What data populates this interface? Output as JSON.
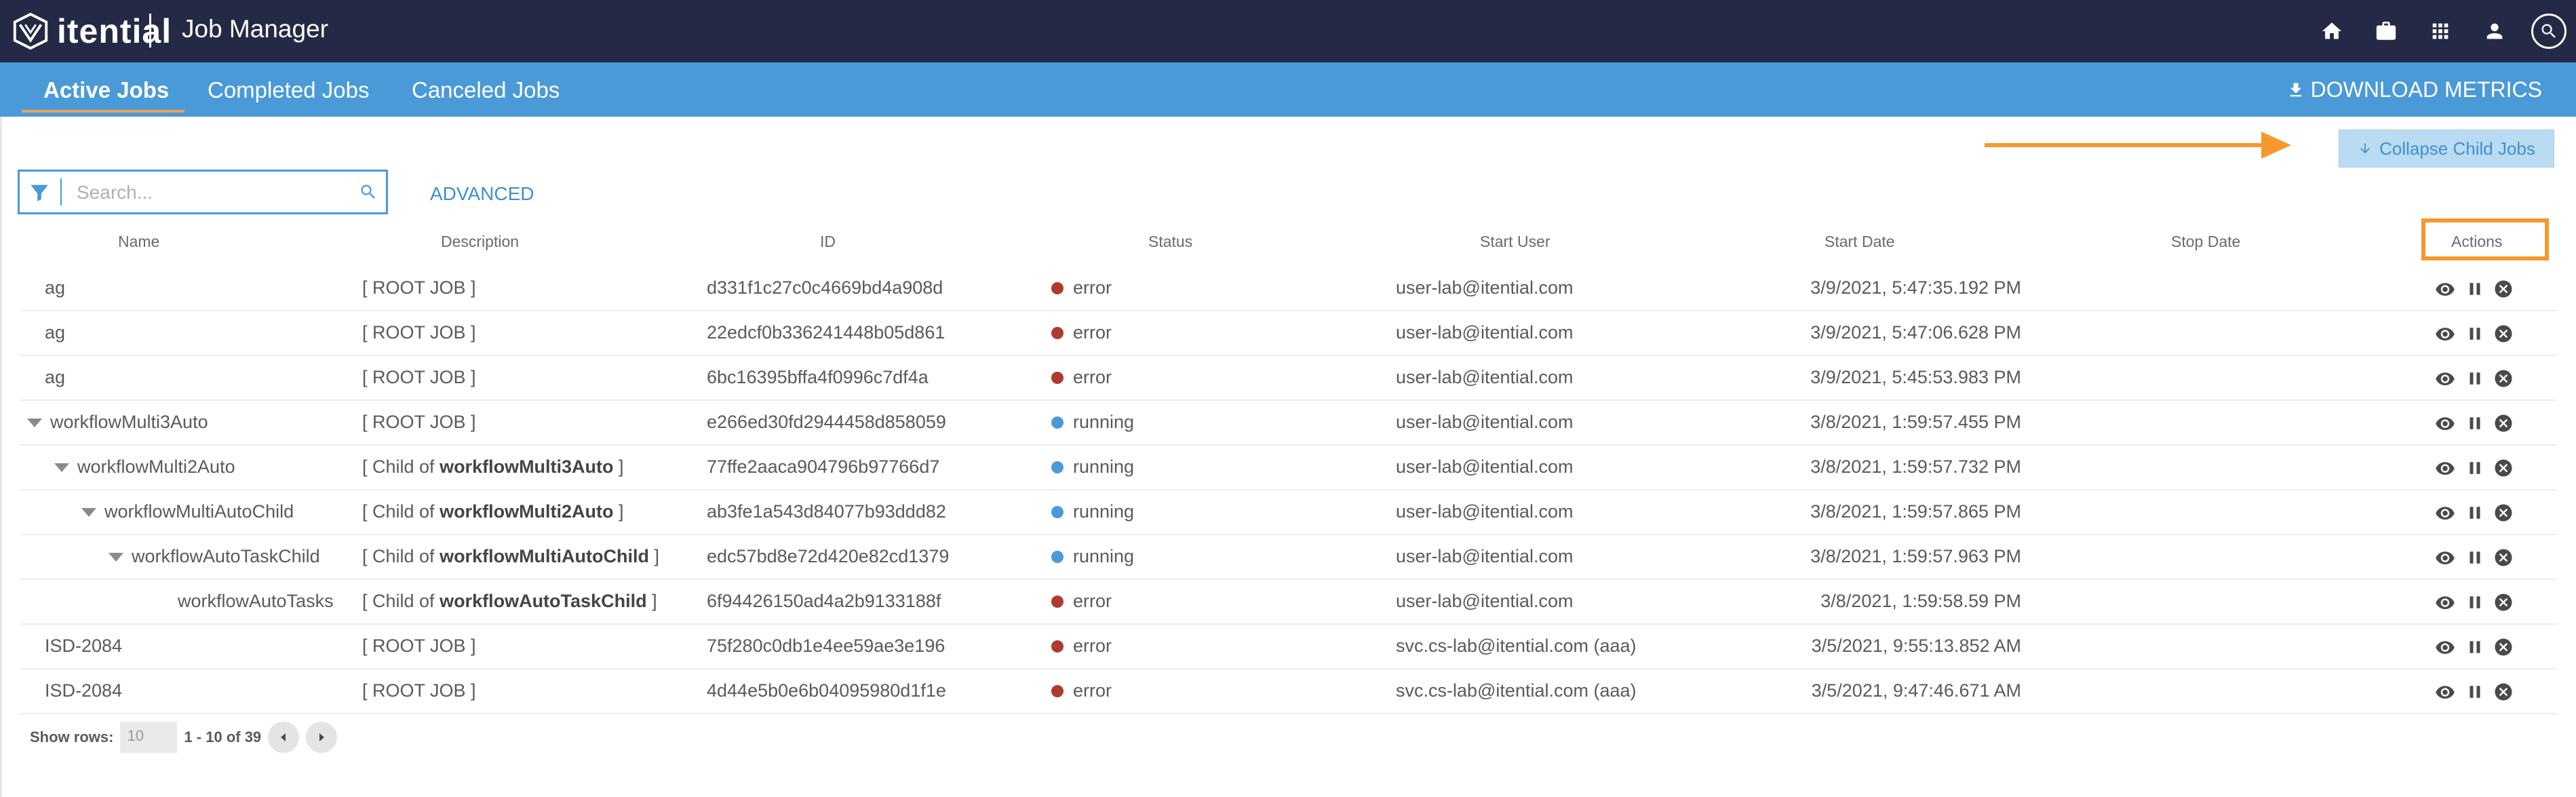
{
  "header": {
    "brand": "itential",
    "app_title": "Job Manager",
    "icons": [
      "home-icon",
      "briefcase-icon",
      "apps-grid-icon",
      "user-icon",
      "search-icon"
    ]
  },
  "tabs": {
    "items": [
      {
        "label": "Active Jobs",
        "active": true
      },
      {
        "label": "Completed Jobs",
        "active": false
      },
      {
        "label": "Canceled Jobs",
        "active": false
      }
    ],
    "download_label": "DOWNLOAD METRICS"
  },
  "toolbar": {
    "collapse_label": "Collapse Child Jobs",
    "search_placeholder": "Search...",
    "advanced_label": "ADVANCED"
  },
  "table": {
    "columns": [
      "Name",
      "Description",
      "ID",
      "Status",
      "Start User",
      "Start Date",
      "Stop Date",
      "Actions"
    ],
    "rows": [
      {
        "name": "ag",
        "desc_prefix": "[ ROOT JOB ]",
        "desc_bold": "",
        "desc_suffix": "",
        "id": "d331f1c27c0c4669bd4a908d",
        "status": "error",
        "user": "user-lab@itential.com",
        "start": "3/9/2021, 5:47:35.192 PM",
        "stop": "",
        "indent": 0,
        "expanded": false
      },
      {
        "name": "ag",
        "desc_prefix": "[ ROOT JOB ]",
        "desc_bold": "",
        "desc_suffix": "",
        "id": "22edcf0b336241448b05d861",
        "status": "error",
        "user": "user-lab@itential.com",
        "start": "3/9/2021, 5:47:06.628 PM",
        "stop": "",
        "indent": 0,
        "expanded": false
      },
      {
        "name": "ag",
        "desc_prefix": "[ ROOT JOB ]",
        "desc_bold": "",
        "desc_suffix": "",
        "id": "6bc16395bffa4f0996c7df4a",
        "status": "error",
        "user": "user-lab@itential.com",
        "start": "3/9/2021, 5:45:53.983 PM",
        "stop": "",
        "indent": 0,
        "expanded": false
      },
      {
        "name": "workflowMulti3Auto",
        "desc_prefix": "[ ROOT JOB ]",
        "desc_bold": "",
        "desc_suffix": "",
        "id": "e266ed30fd2944458d858059",
        "status": "running",
        "user": "user-lab@itential.com",
        "start": "3/8/2021, 1:59:57.455 PM",
        "stop": "",
        "indent": 0,
        "expanded": true
      },
      {
        "name": "workflowMulti2Auto",
        "desc_prefix": "[ Child of ",
        "desc_bold": "workflowMulti3Auto",
        "desc_suffix": " ]",
        "id": "77ffe2aaca904796b97766d7",
        "status": "running",
        "user": "user-lab@itential.com",
        "start": "3/8/2021, 1:59:57.732 PM",
        "stop": "",
        "indent": 1,
        "expanded": true
      },
      {
        "name": "workflowMultiAutoChild",
        "desc_prefix": "[ Child of ",
        "desc_bold": "workflowMulti2Auto",
        "desc_suffix": " ]",
        "id": "ab3fe1a543d84077b93ddd82",
        "status": "running",
        "user": "user-lab@itential.com",
        "start": "3/8/2021, 1:59:57.865 PM",
        "stop": "",
        "indent": 2,
        "expanded": true
      },
      {
        "name": "workflowAutoTaskChild",
        "desc_prefix": "[ Child of ",
        "desc_bold": "workflowMultiAutoChild",
        "desc_suffix": " ]",
        "id": "edc57bd8e72d420e82cd1379",
        "status": "running",
        "user": "user-lab@itential.com",
        "start": "3/8/2021, 1:59:57.963 PM",
        "stop": "",
        "indent": 3,
        "expanded": true
      },
      {
        "name": "workflowAutoTasks",
        "desc_prefix": "[ Child of ",
        "desc_bold": "workflowAutoTaskChild",
        "desc_suffix": " ]",
        "id": "6f94426150ad4a2b9133188f",
        "status": "error",
        "user": "user-lab@itential.com",
        "start": "3/8/2021, 1:59:58.59 PM",
        "stop": "",
        "indent": 4,
        "expanded": false
      },
      {
        "name": "ISD-2084",
        "desc_prefix": "[ ROOT JOB ]",
        "desc_bold": "",
        "desc_suffix": "",
        "id": "75f280c0db1e4ee59ae3e196",
        "status": "error",
        "user": "svc.cs-lab@itential.com (aaa)",
        "start": "3/5/2021, 9:55:13.852 AM",
        "stop": "",
        "indent": 0,
        "expanded": false
      },
      {
        "name": "ISD-2084",
        "desc_prefix": "[ ROOT JOB ]",
        "desc_bold": "",
        "desc_suffix": "",
        "id": "4d44e5b0e6b04095980d1f1e",
        "status": "error",
        "user": "svc.cs-lab@itential.com (aaa)",
        "start": "3/5/2021, 9:47:46.671 AM",
        "stop": "",
        "indent": 0,
        "expanded": false
      }
    ],
    "status_colors": {
      "error": "#b03a2e",
      "running": "#4a9ad8"
    },
    "row_action_icons": [
      "eye-icon",
      "pause-icon",
      "cancel-icon"
    ]
  },
  "pagination": {
    "show_rows_label": "Show rows:",
    "rows_value": "10",
    "range": "1 - 10 of 39"
  },
  "colors": {
    "topbar": "#242a45",
    "tabbar": "#4a9ad8",
    "accent_orange": "#f7982c"
  }
}
